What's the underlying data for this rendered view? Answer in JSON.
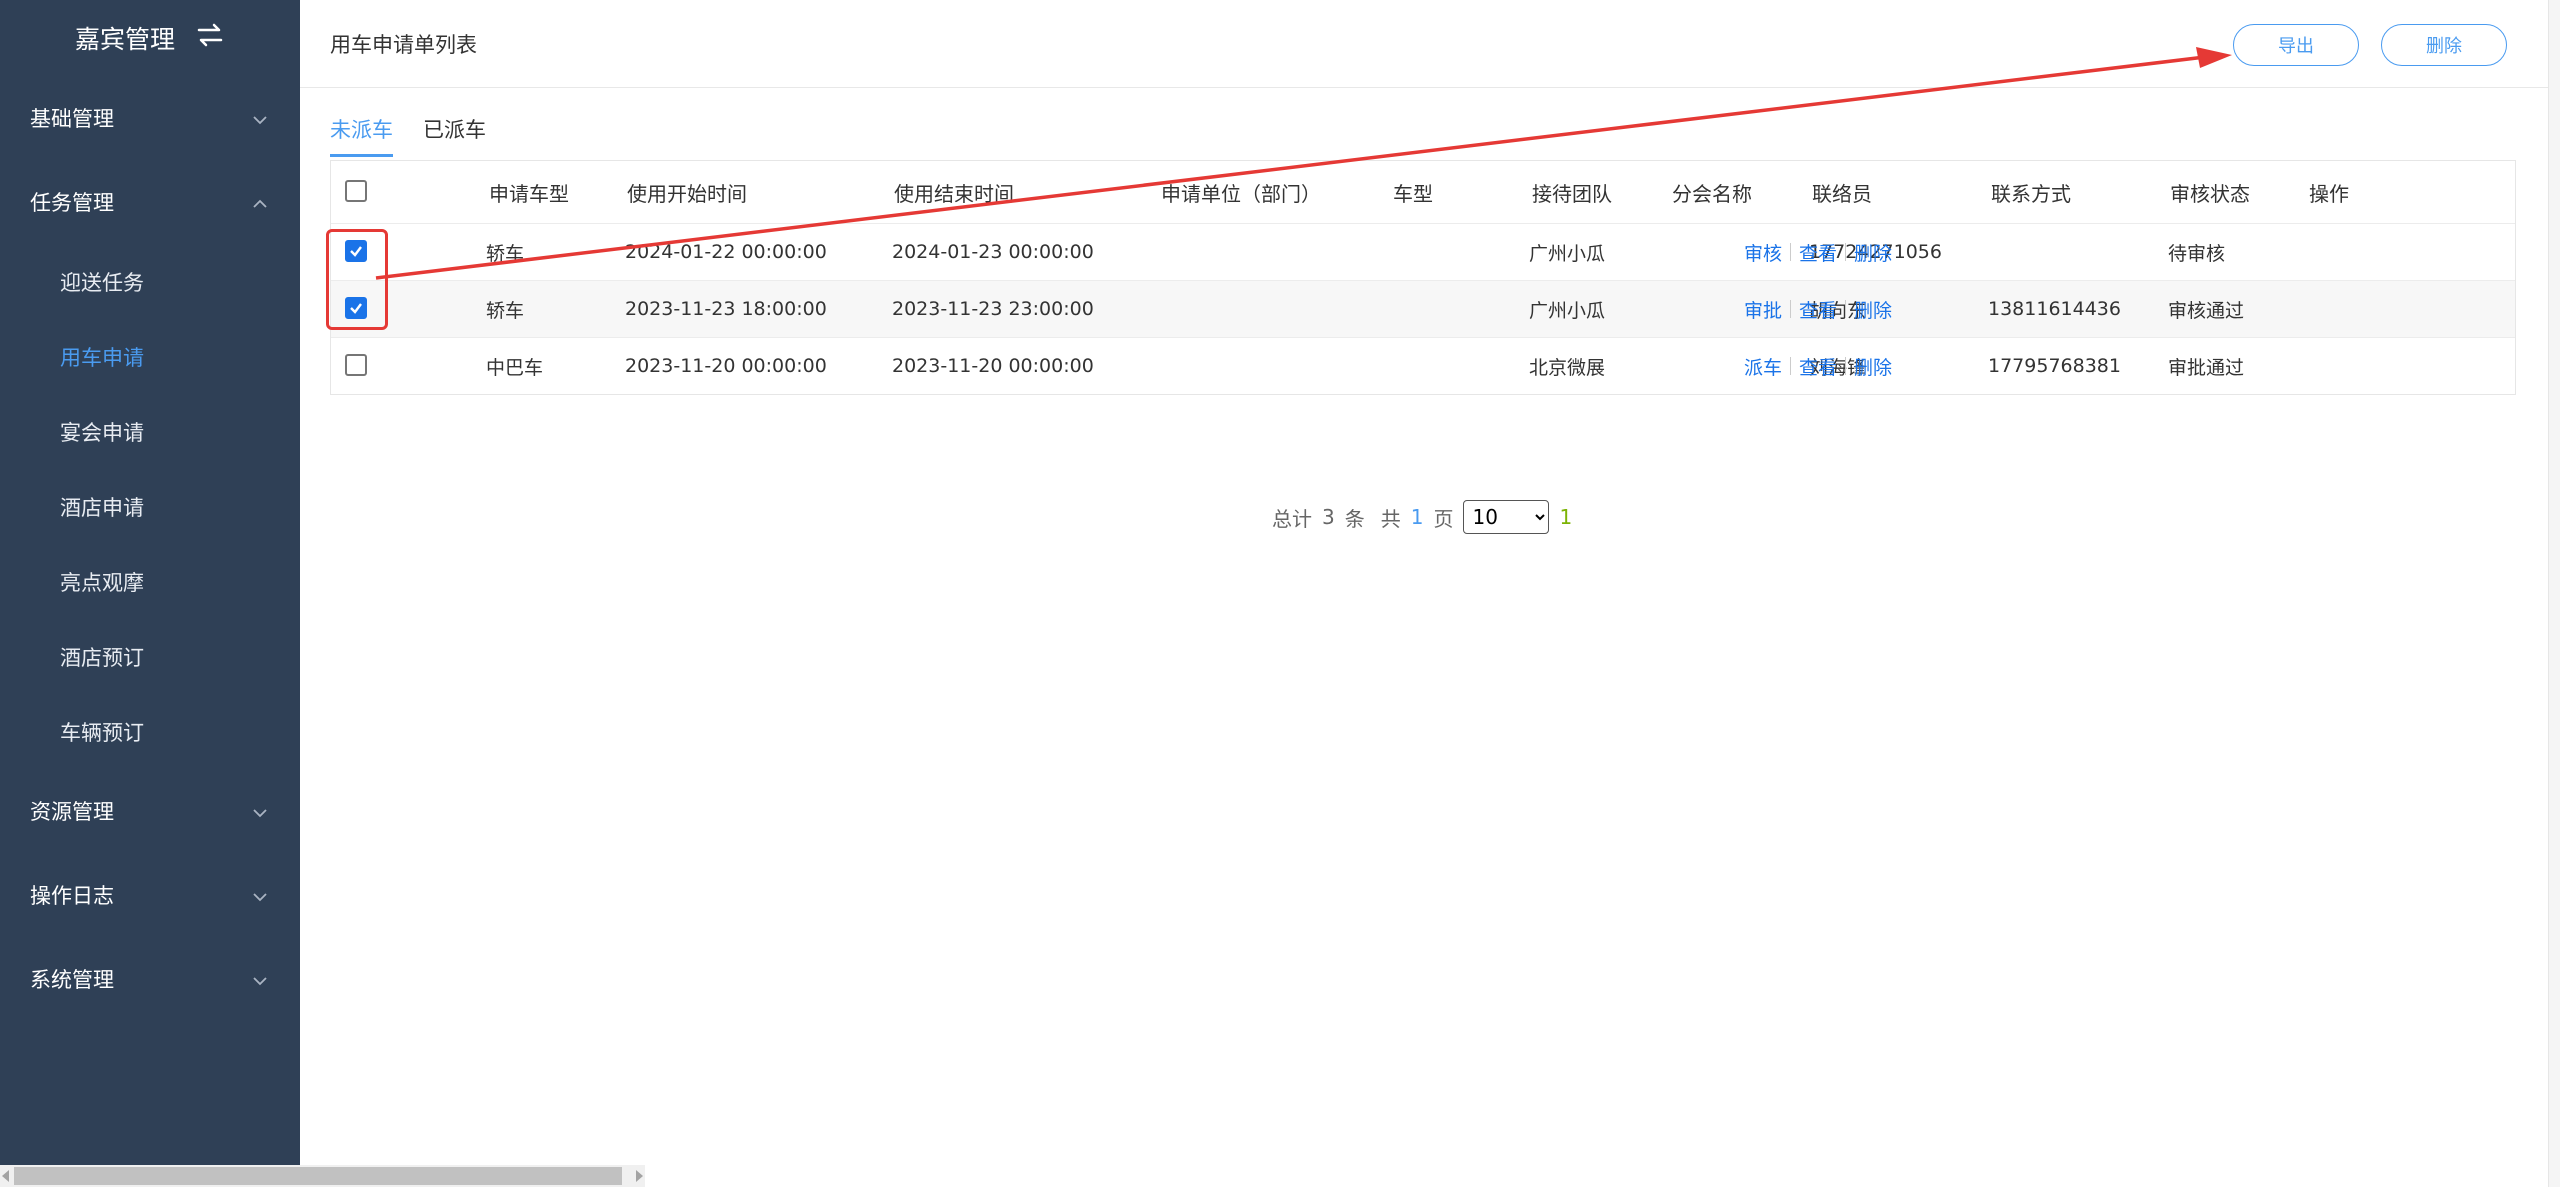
{
  "sidebar": {
    "brand": "嘉宾管理",
    "groups": [
      {
        "label": "基础管理"
      },
      {
        "label": "任务管理"
      },
      {
        "label": "资源管理"
      },
      {
        "label": "操作日志"
      },
      {
        "label": "系统管理"
      }
    ],
    "sub_items": [
      "迎送任务",
      "用车申请",
      "宴会申请",
      "酒店申请",
      "亮点观摩",
      "酒店预订",
      "车辆预订"
    ],
    "active_item": "用车申请"
  },
  "header": {
    "title": "用车申请单列表",
    "export_label": "导出",
    "delete_label": "删除"
  },
  "tabs": [
    {
      "label": "未派车",
      "active": true
    },
    {
      "label": "已派车",
      "active": false
    }
  ],
  "table": {
    "columns": [
      "申请车型",
      "使用开始时间",
      "使用结束时间",
      "申请单位（部门）",
      "车型",
      "接待团队",
      "分会名称",
      "联络员",
      "联系方式",
      "审核状态",
      "操作"
    ],
    "rows": [
      {
        "checked": true,
        "vehicle": "轿车",
        "start": "2024-01-22 00:00:00",
        "end": "2024-01-23 00:00:00",
        "unit": "",
        "type": "",
        "team": "广州小瓜",
        "branch": "",
        "liaison": "",
        "contact": "17724271056",
        "status": "待审核",
        "op1": "审核",
        "op2": "查看",
        "op3": "删除"
      },
      {
        "checked": true,
        "vehicle": "轿车",
        "start": "2023-11-23 18:00:00",
        "end": "2023-11-23 23:00:00",
        "unit": "",
        "type": "",
        "team": "广州小瓜",
        "branch": "",
        "liaison": "胡向东",
        "contact": "13811614436",
        "status": "审核通过",
        "op1": "审批",
        "op2": "查看",
        "op3": "删除"
      },
      {
        "checked": false,
        "vehicle": "中巴车",
        "start": "2023-11-20 00:00:00",
        "end": "2023-11-20 00:00:00",
        "unit": "",
        "type": "",
        "team": "北京微展",
        "branch": "",
        "liaison": "刘海锋",
        "contact": "17795768381",
        "status": "审批通过",
        "op1": "派车",
        "op2": "查看",
        "op3": "删除"
      }
    ]
  },
  "pager": {
    "total_prefix": "总计",
    "total": "3",
    "total_suffix": "条",
    "pages_prefix": "共",
    "pages": "1",
    "pages_suffix": "页",
    "page_size": "10",
    "current_page": "1"
  },
  "colors": {
    "sidebar_bg": "#2f4056",
    "accent": "#4a9bf0",
    "link": "#1a73e8",
    "annotation": "#e53935"
  }
}
